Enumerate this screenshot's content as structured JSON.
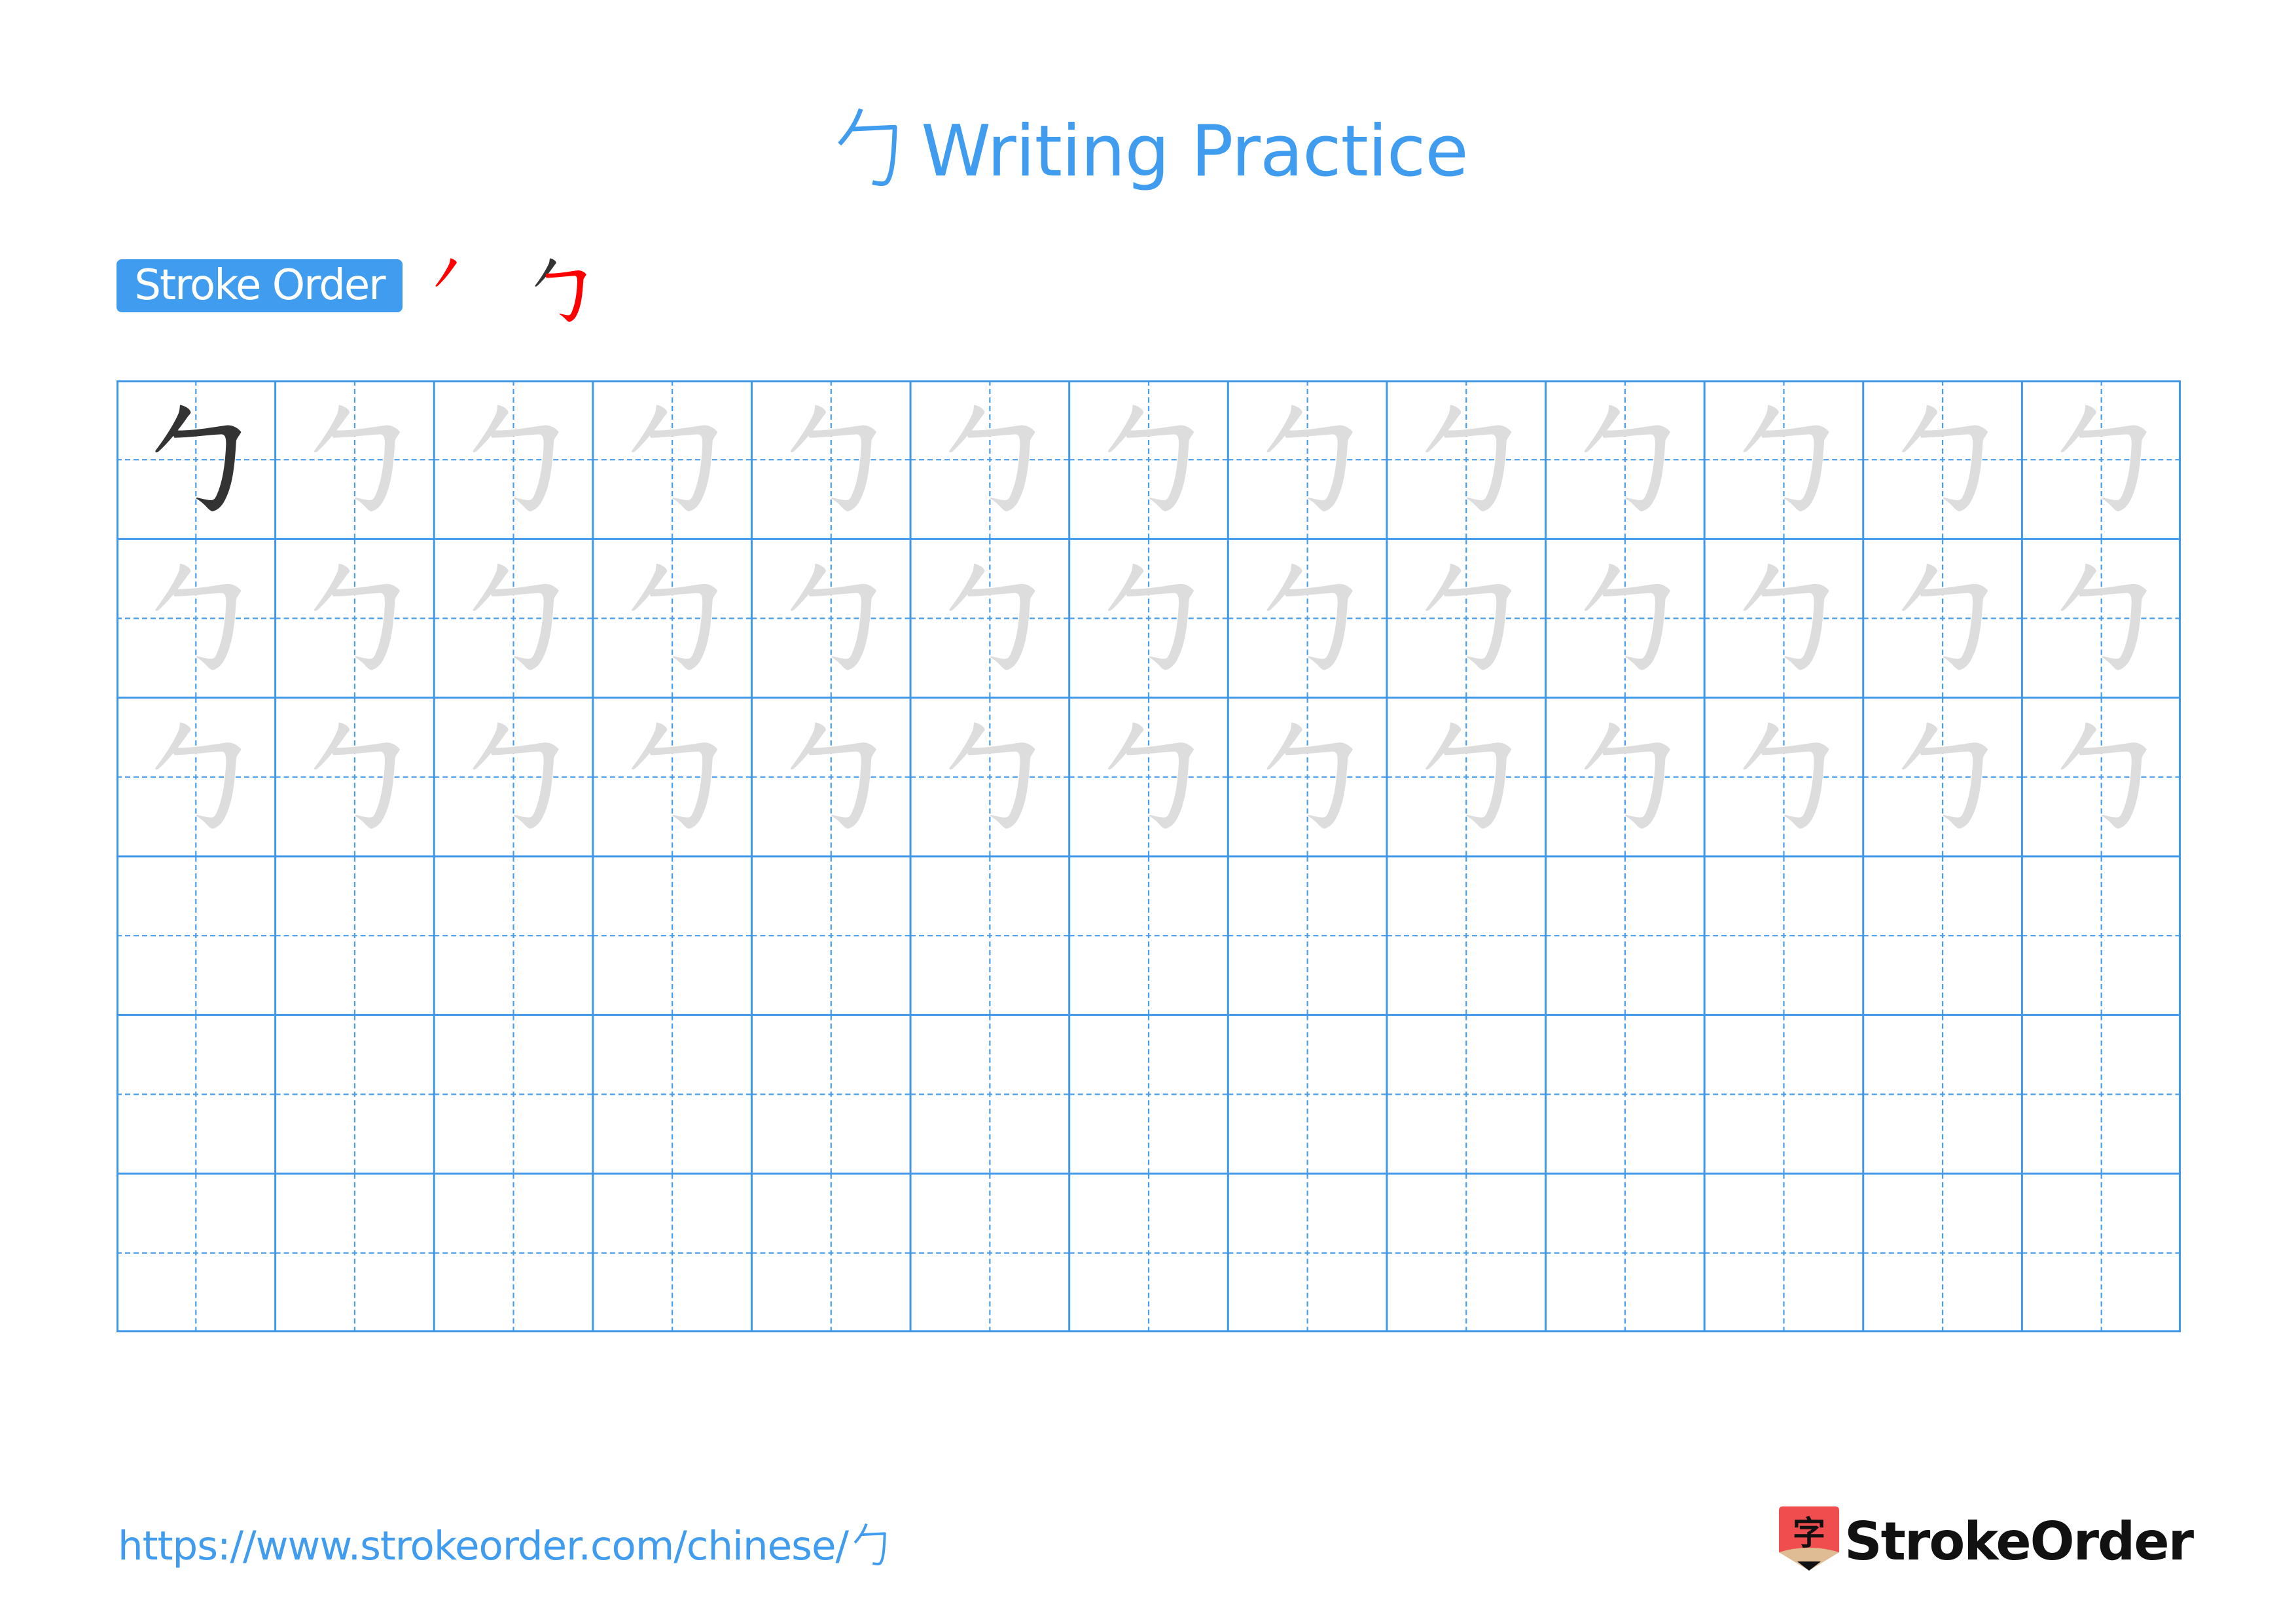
{
  "page": {
    "character": "勹",
    "title_suffix": "Writing Practice",
    "title": "勹 Writing Practice"
  },
  "stroke_order": {
    "label": "Stroke Order",
    "stroke_count": 2,
    "steps": [
      {
        "step": 1,
        "strokes_done": 0,
        "current_stroke": 1
      },
      {
        "step": 2,
        "strokes_done": 1,
        "current_stroke": 2
      }
    ]
  },
  "grid": {
    "rows": 6,
    "columns": 13,
    "solid_character_cells": 1,
    "traced_rows": 3,
    "empty_rows": 3
  },
  "colors": {
    "accent": "#409CEF",
    "grid_line": "#3F97EA",
    "guide_line": "#4A9DEB",
    "current_stroke": "#FF0000",
    "done_stroke": "#333333",
    "model_character": "#333333",
    "trace_character": "#DDDDDD",
    "logo_red": "#F04E4E",
    "logo_tan": "#E0BC94"
  },
  "footer": {
    "url": "https://www.strokeorder.com/chinese/",
    "url_character": "勹",
    "brand": "StrokeOrder",
    "logo_char": "字"
  }
}
